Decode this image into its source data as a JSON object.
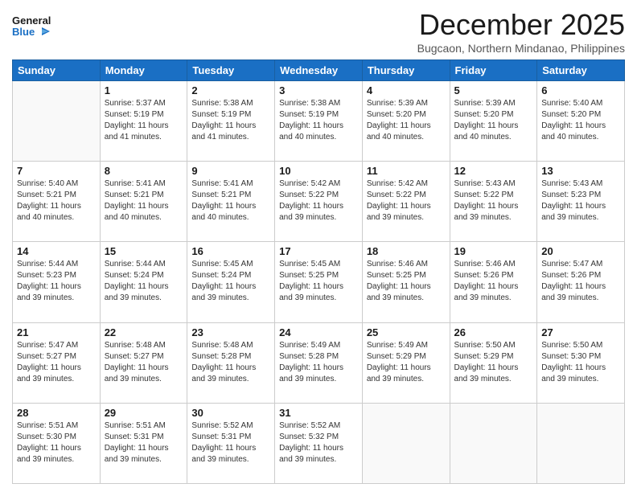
{
  "header": {
    "logo_general": "General",
    "logo_blue": "Blue",
    "title": "December 2025",
    "subtitle": "Bugcaon, Northern Mindanao, Philippines"
  },
  "weekdays": [
    "Sunday",
    "Monday",
    "Tuesday",
    "Wednesday",
    "Thursday",
    "Friday",
    "Saturday"
  ],
  "weeks": [
    [
      {
        "day": "",
        "sunrise": "",
        "sunset": "",
        "daylight": ""
      },
      {
        "day": "1",
        "sunrise": "Sunrise: 5:37 AM",
        "sunset": "Sunset: 5:19 PM",
        "daylight": "Daylight: 11 hours and 41 minutes."
      },
      {
        "day": "2",
        "sunrise": "Sunrise: 5:38 AM",
        "sunset": "Sunset: 5:19 PM",
        "daylight": "Daylight: 11 hours and 41 minutes."
      },
      {
        "day": "3",
        "sunrise": "Sunrise: 5:38 AM",
        "sunset": "Sunset: 5:19 PM",
        "daylight": "Daylight: 11 hours and 40 minutes."
      },
      {
        "day": "4",
        "sunrise": "Sunrise: 5:39 AM",
        "sunset": "Sunset: 5:20 PM",
        "daylight": "Daylight: 11 hours and 40 minutes."
      },
      {
        "day": "5",
        "sunrise": "Sunrise: 5:39 AM",
        "sunset": "Sunset: 5:20 PM",
        "daylight": "Daylight: 11 hours and 40 minutes."
      },
      {
        "day": "6",
        "sunrise": "Sunrise: 5:40 AM",
        "sunset": "Sunset: 5:20 PM",
        "daylight": "Daylight: 11 hours and 40 minutes."
      }
    ],
    [
      {
        "day": "7",
        "sunrise": "Sunrise: 5:40 AM",
        "sunset": "Sunset: 5:21 PM",
        "daylight": "Daylight: 11 hours and 40 minutes."
      },
      {
        "day": "8",
        "sunrise": "Sunrise: 5:41 AM",
        "sunset": "Sunset: 5:21 PM",
        "daylight": "Daylight: 11 hours and 40 minutes."
      },
      {
        "day": "9",
        "sunrise": "Sunrise: 5:41 AM",
        "sunset": "Sunset: 5:21 PM",
        "daylight": "Daylight: 11 hours and 40 minutes."
      },
      {
        "day": "10",
        "sunrise": "Sunrise: 5:42 AM",
        "sunset": "Sunset: 5:22 PM",
        "daylight": "Daylight: 11 hours and 39 minutes."
      },
      {
        "day": "11",
        "sunrise": "Sunrise: 5:42 AM",
        "sunset": "Sunset: 5:22 PM",
        "daylight": "Daylight: 11 hours and 39 minutes."
      },
      {
        "day": "12",
        "sunrise": "Sunrise: 5:43 AM",
        "sunset": "Sunset: 5:22 PM",
        "daylight": "Daylight: 11 hours and 39 minutes."
      },
      {
        "day": "13",
        "sunrise": "Sunrise: 5:43 AM",
        "sunset": "Sunset: 5:23 PM",
        "daylight": "Daylight: 11 hours and 39 minutes."
      }
    ],
    [
      {
        "day": "14",
        "sunrise": "Sunrise: 5:44 AM",
        "sunset": "Sunset: 5:23 PM",
        "daylight": "Daylight: 11 hours and 39 minutes."
      },
      {
        "day": "15",
        "sunrise": "Sunrise: 5:44 AM",
        "sunset": "Sunset: 5:24 PM",
        "daylight": "Daylight: 11 hours and 39 minutes."
      },
      {
        "day": "16",
        "sunrise": "Sunrise: 5:45 AM",
        "sunset": "Sunset: 5:24 PM",
        "daylight": "Daylight: 11 hours and 39 minutes."
      },
      {
        "day": "17",
        "sunrise": "Sunrise: 5:45 AM",
        "sunset": "Sunset: 5:25 PM",
        "daylight": "Daylight: 11 hours and 39 minutes."
      },
      {
        "day": "18",
        "sunrise": "Sunrise: 5:46 AM",
        "sunset": "Sunset: 5:25 PM",
        "daylight": "Daylight: 11 hours and 39 minutes."
      },
      {
        "day": "19",
        "sunrise": "Sunrise: 5:46 AM",
        "sunset": "Sunset: 5:26 PM",
        "daylight": "Daylight: 11 hours and 39 minutes."
      },
      {
        "day": "20",
        "sunrise": "Sunrise: 5:47 AM",
        "sunset": "Sunset: 5:26 PM",
        "daylight": "Daylight: 11 hours and 39 minutes."
      }
    ],
    [
      {
        "day": "21",
        "sunrise": "Sunrise: 5:47 AM",
        "sunset": "Sunset: 5:27 PM",
        "daylight": "Daylight: 11 hours and 39 minutes."
      },
      {
        "day": "22",
        "sunrise": "Sunrise: 5:48 AM",
        "sunset": "Sunset: 5:27 PM",
        "daylight": "Daylight: 11 hours and 39 minutes."
      },
      {
        "day": "23",
        "sunrise": "Sunrise: 5:48 AM",
        "sunset": "Sunset: 5:28 PM",
        "daylight": "Daylight: 11 hours and 39 minutes."
      },
      {
        "day": "24",
        "sunrise": "Sunrise: 5:49 AM",
        "sunset": "Sunset: 5:28 PM",
        "daylight": "Daylight: 11 hours and 39 minutes."
      },
      {
        "day": "25",
        "sunrise": "Sunrise: 5:49 AM",
        "sunset": "Sunset: 5:29 PM",
        "daylight": "Daylight: 11 hours and 39 minutes."
      },
      {
        "day": "26",
        "sunrise": "Sunrise: 5:50 AM",
        "sunset": "Sunset: 5:29 PM",
        "daylight": "Daylight: 11 hours and 39 minutes."
      },
      {
        "day": "27",
        "sunrise": "Sunrise: 5:50 AM",
        "sunset": "Sunset: 5:30 PM",
        "daylight": "Daylight: 11 hours and 39 minutes."
      }
    ],
    [
      {
        "day": "28",
        "sunrise": "Sunrise: 5:51 AM",
        "sunset": "Sunset: 5:30 PM",
        "daylight": "Daylight: 11 hours and 39 minutes."
      },
      {
        "day": "29",
        "sunrise": "Sunrise: 5:51 AM",
        "sunset": "Sunset: 5:31 PM",
        "daylight": "Daylight: 11 hours and 39 minutes."
      },
      {
        "day": "30",
        "sunrise": "Sunrise: 5:52 AM",
        "sunset": "Sunset: 5:31 PM",
        "daylight": "Daylight: 11 hours and 39 minutes."
      },
      {
        "day": "31",
        "sunrise": "Sunrise: 5:52 AM",
        "sunset": "Sunset: 5:32 PM",
        "daylight": "Daylight: 11 hours and 39 minutes."
      },
      {
        "day": "",
        "sunrise": "",
        "sunset": "",
        "daylight": ""
      },
      {
        "day": "",
        "sunrise": "",
        "sunset": "",
        "daylight": ""
      },
      {
        "day": "",
        "sunrise": "",
        "sunset": "",
        "daylight": ""
      }
    ]
  ]
}
